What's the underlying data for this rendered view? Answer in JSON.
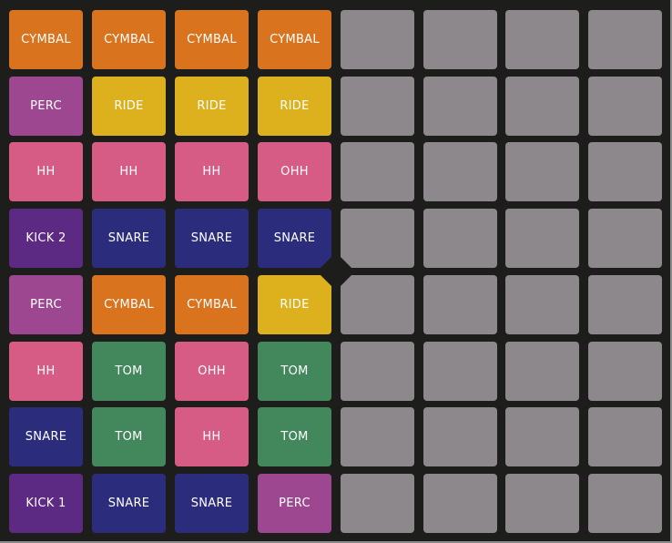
{
  "colors": {
    "CYMBAL": "#d9731e",
    "RIDE": "#dcb11d",
    "PERC": "#9e4791",
    "HH": "#d65c86",
    "OHH": "#d65c86",
    "KICK 1": "#5c2a82",
    "KICK 2": "#5c2a82",
    "SNARE": "#2b2d7c",
    "TOM": "#43875c",
    "empty": "#8c888b"
  },
  "grid": {
    "columns": 8,
    "rows": [
      [
        "CYMBAL",
        "CYMBAL",
        "CYMBAL",
        "CYMBAL",
        "",
        "",
        "",
        ""
      ],
      [
        "PERC",
        "RIDE",
        "RIDE",
        "RIDE",
        "",
        "",
        "",
        ""
      ],
      [
        "HH",
        "HH",
        "HH",
        "OHH",
        "",
        "",
        "",
        ""
      ],
      [
        "KICK 2",
        "SNARE",
        "SNARE",
        "SNARE",
        "",
        "",
        "",
        ""
      ],
      [
        "PERC",
        "CYMBAL",
        "CYMBAL",
        "RIDE",
        "",
        "",
        "",
        ""
      ],
      [
        "HH",
        "TOM",
        "OHH",
        "TOM",
        "",
        "",
        "",
        ""
      ],
      [
        "SNARE",
        "TOM",
        "HH",
        "TOM",
        "",
        "",
        "",
        ""
      ],
      [
        "KICK 1",
        "SNARE",
        "SNARE",
        "PERC",
        "",
        "",
        "",
        ""
      ]
    ]
  }
}
